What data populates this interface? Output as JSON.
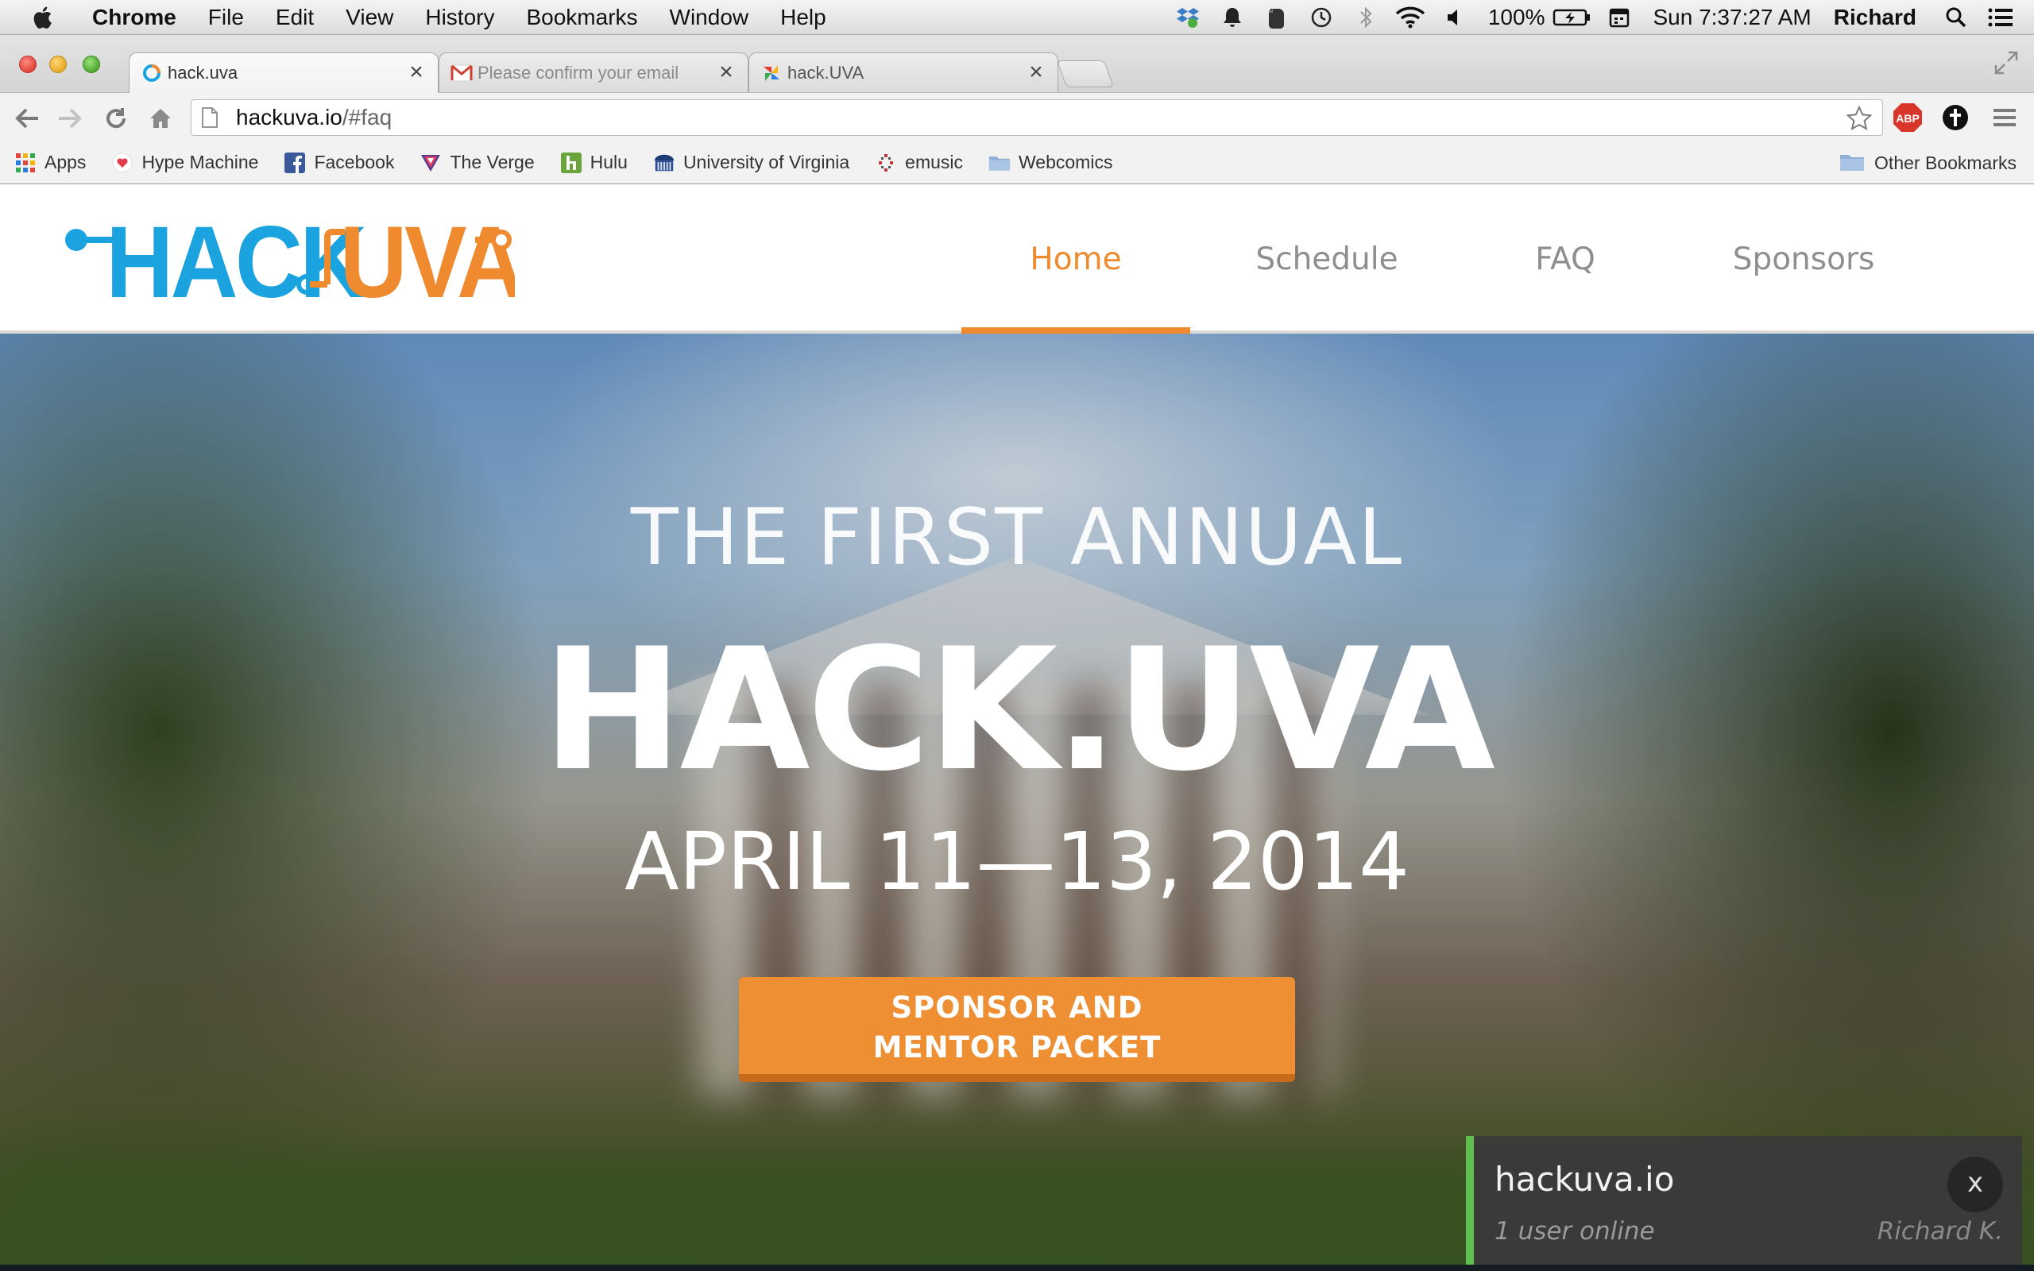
{
  "menubar": {
    "app_name": "Chrome",
    "menus": [
      "File",
      "Edit",
      "View",
      "History",
      "Bookmarks",
      "Window",
      "Help"
    ],
    "battery": "100%",
    "clock": "Sun 7:37:27 AM",
    "user": "Richard"
  },
  "tabs": [
    {
      "title": "hack.uva",
      "favicon": "hackuva-ring-icon",
      "active": true
    },
    {
      "title": "Please confirm your email",
      "favicon": "gmail-icon",
      "active": false
    },
    {
      "title": "hack.UVA",
      "favicon": "pinwheel-icon",
      "active": false
    }
  ],
  "omnibox": {
    "host": "hackuva.io",
    "path": "/#faq"
  },
  "bookmarks": [
    {
      "label": "Apps",
      "icon": "apps-grid-icon"
    },
    {
      "label": "Hype Machine",
      "icon": "hype-machine-icon"
    },
    {
      "label": "Facebook",
      "icon": "facebook-icon"
    },
    {
      "label": "The Verge",
      "icon": "verge-icon"
    },
    {
      "label": "Hulu",
      "icon": "hulu-icon"
    },
    {
      "label": "University of Virginia",
      "icon": "uva-icon"
    },
    {
      "label": "emusic",
      "icon": "emusic-icon"
    },
    {
      "label": "Webcomics",
      "icon": "folder-icon"
    }
  ],
  "other_bookmarks": "Other Bookmarks",
  "site": {
    "logo_left": "HACK",
    "logo_right": "UVA",
    "nav": [
      "Home",
      "Schedule",
      "FAQ",
      "Sponsors"
    ],
    "active_nav": "Home",
    "hero": {
      "subtitle": "THE FIRST ANNUAL",
      "title": "HACK.UVA",
      "date": "APRIL 11—13, 2014",
      "cta_line1": "SPONSOR AND",
      "cta_line2": "MENTOR PACKET"
    }
  },
  "chat": {
    "title": "hackuva.io",
    "users_online": "1 user online",
    "user_name": "Richard K.",
    "close_label": "x"
  },
  "colors": {
    "brand_orange": "#ef8a2f",
    "brand_blue": "#1aa3df",
    "chat_green": "#5fbf4f"
  }
}
